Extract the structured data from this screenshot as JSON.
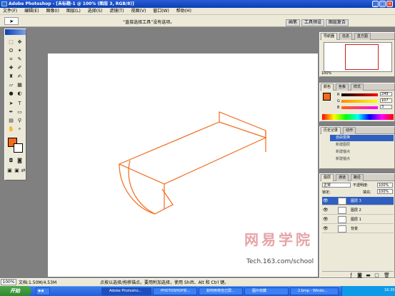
{
  "window": {
    "title": "Adobe Photoshop - [未标题-1 @ 100% (图层 3, RGB/8)]",
    "min": "_",
    "max": "□",
    "close": "×"
  },
  "menu": [
    "文件(F)",
    "编辑(E)",
    "图像(I)",
    "图层(L)",
    "选择(S)",
    "滤镜(T)",
    "视图(V)",
    "窗口(W)",
    "帮助(H)"
  ],
  "options": {
    "hint": "“直接选择工具”没有选项。",
    "tabs": [
      "画笔",
      "工具预设",
      "图层复合"
    ]
  },
  "nav_panel": {
    "tabs": [
      "导航器",
      "信息",
      "直方图"
    ],
    "zoom": "100%"
  },
  "color_panel": {
    "tabs": [
      "颜色",
      "色板",
      "样式"
    ],
    "rows": [
      {
        "label": "R",
        "value": "249",
        "color": "#e02020"
      },
      {
        "label": "G",
        "value": "107",
        "color": "#20a020"
      },
      {
        "label": "B",
        "value": "3",
        "color": "#2040e0"
      }
    ],
    "foreground": "#f26a1b"
  },
  "history_panel": {
    "tabs": [
      "历史记录",
      "动作"
    ],
    "items": [
      "自由变换",
      "新建图层",
      "新建锚点",
      "新建锚点"
    ]
  },
  "layers_panel": {
    "tabs": [
      "图层",
      "通道",
      "路径"
    ],
    "blend_mode": "正常",
    "opacity_label": "不透明度:",
    "opacity": "100%",
    "lock_label": "锁定:",
    "fill_label": "填充:",
    "fill": "100%",
    "layers": [
      {
        "name": "图层 3",
        "active": true
      },
      {
        "name": "图层 2",
        "active": false
      },
      {
        "name": "图层 1",
        "active": false
      },
      {
        "name": "背景",
        "active": false
      }
    ]
  },
  "watermark": {
    "text": "网易学院",
    "url": "Tech.163.com/school"
  },
  "status": {
    "zoom": "100%",
    "doc": "文档:1.50M/4.53M",
    "message": "点按以选择/拖移锚点。要用附加选择，使用 Shift、Alt 和 Ctrl 键。"
  },
  "taskbar": {
    "start": "开始",
    "tasks": [
      "Adobe Photosho...",
      "PHOTOSHOP实...",
      "如何用将自己屏...",
      "图片收藏",
      "2.bmp - Windo..."
    ],
    "clock": "16:35"
  },
  "colors": {
    "accent": "#f26a1b",
    "title_blue": "#0a3fb3",
    "chrome": "#ece9d8"
  }
}
